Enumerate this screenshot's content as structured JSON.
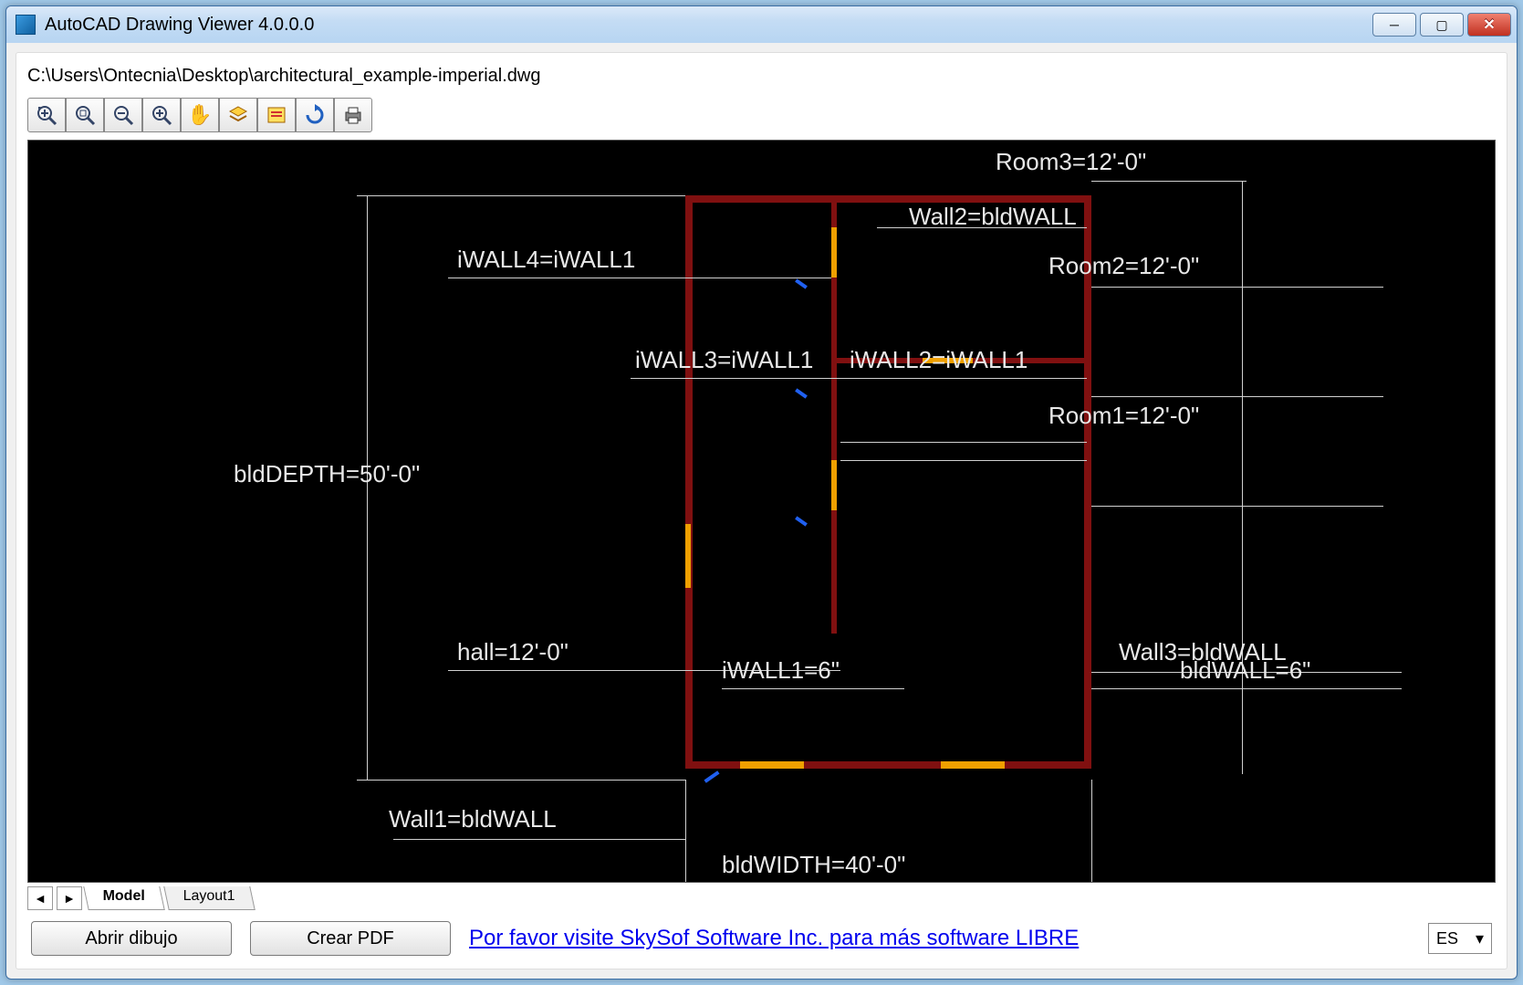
{
  "window": {
    "title": "AutoCAD Drawing Viewer 4.0.0.0"
  },
  "file_path": "C:\\Users\\Ontecnia\\Desktop\\architectural_example-imperial.dwg",
  "toolbar": {
    "zoom_extents": "Zoom Extents",
    "zoom_window": "Zoom Window",
    "zoom_out": "Zoom Out",
    "zoom_in": "Zoom In",
    "pan": "Pan",
    "layers": "Layers",
    "legend": "Legend",
    "refresh": "Refresh",
    "print": "Print"
  },
  "tabs": {
    "model": "Model",
    "layout1": "Layout1"
  },
  "buttons": {
    "open_drawing": "Abrir dibujo",
    "create_pdf": "Crear PDF"
  },
  "promo_link": "Por favor visite SkySof Software Inc. para más software LIBRE",
  "language": "ES",
  "drawing_labels": {
    "bldDepth": "bldDEPTH=50'-0\"",
    "iWall4": "iWALL4=iWALL1",
    "iWall3": "iWALL3=iWALL1",
    "iWall2": "iWALL2=iWALL1",
    "hall": "hall=12'-0\"",
    "iWall1": "iWALL1=6\"",
    "wall1": "Wall1=bldWALL",
    "bldWidth": "bldWIDTH=40'-0\"",
    "room3": "Room3=12'-0\"",
    "wall2": "Wall2=bldWALL",
    "room2": "Room2=12'-0\"",
    "room1": "Room1=12'-0\"",
    "wall3": "Wall3=bldWALL",
    "bldWall": "bldWALL=6\""
  }
}
